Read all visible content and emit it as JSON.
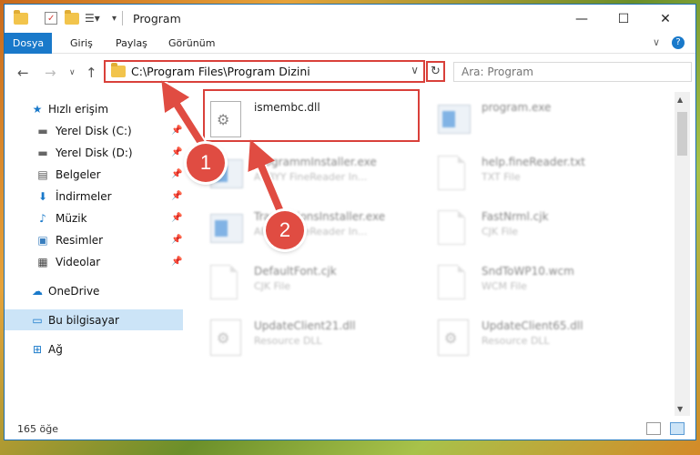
{
  "window": {
    "title": "Program",
    "controls": {
      "minimize": "—",
      "maximize": "☐",
      "close": "✕"
    }
  },
  "ribbon": {
    "tabs": [
      "Dosya",
      "Giriş",
      "Paylaş",
      "Görünüm"
    ]
  },
  "address": {
    "path": "C:\\Program Files\\Program Dizini",
    "search_placeholder": "Ara: Program"
  },
  "sidebar": {
    "items": [
      {
        "label": "Hızlı erişim",
        "icon": "star-icon"
      },
      {
        "label": "Yerel Disk (C:)",
        "icon": "drive-icon",
        "pinned": true
      },
      {
        "label": "Yerel Disk (D:)",
        "icon": "drive-icon",
        "pinned": true
      },
      {
        "label": "Belgeler",
        "icon": "documents-icon",
        "pinned": true
      },
      {
        "label": "İndirmeler",
        "icon": "download-icon",
        "pinned": true
      },
      {
        "label": "Müzik",
        "icon": "music-icon",
        "pinned": true
      },
      {
        "label": "Resimler",
        "icon": "pictures-icon",
        "pinned": true
      },
      {
        "label": "Videolar",
        "icon": "videos-icon",
        "pinned": true
      },
      {
        "label": "OneDrive",
        "icon": "cloud-icon"
      },
      {
        "label": "Bu bilgisayar",
        "icon": "computer-icon",
        "selected": true
      },
      {
        "label": "Ağ",
        "icon": "network-icon"
      }
    ]
  },
  "files": [
    {
      "name": "ismembc.dll",
      "type": "",
      "icon": "dll-file-icon"
    },
    {
      "name": "program.exe",
      "type": "",
      "icon": "exe-file-icon"
    },
    {
      "name": "ProgrammInstaller.exe",
      "type": "ABBYY FineReader In...",
      "icon": "installer-icon"
    },
    {
      "name": "help.fineReader.txt",
      "type": "TXT File",
      "icon": "text-file-icon"
    },
    {
      "name": "TranslationsInstaller.exe",
      "type": "ABBYY FineReader In...",
      "icon": "installer-icon"
    },
    {
      "name": "FastNrml.cjk",
      "type": "CJK File",
      "icon": "file-icon"
    },
    {
      "name": "DefaultFont.cjk",
      "type": "CJK File",
      "icon": "file-icon"
    },
    {
      "name": "SndToWP10.wcm",
      "type": "WCM File",
      "icon": "file-icon"
    },
    {
      "name": "UpdateClient21.dll",
      "type": "Resource DLL",
      "icon": "dll-file-icon"
    },
    {
      "name": "UpdateClient65.dll",
      "type": "Resource DLL",
      "icon": "dll-file-icon"
    }
  ],
  "status": {
    "count_text": "165 öğe"
  },
  "annotations": {
    "step1": "1",
    "step2": "2"
  },
  "colors": {
    "accent": "#1979ca",
    "highlight": "#d9403a",
    "selected": "#cce4f7"
  }
}
